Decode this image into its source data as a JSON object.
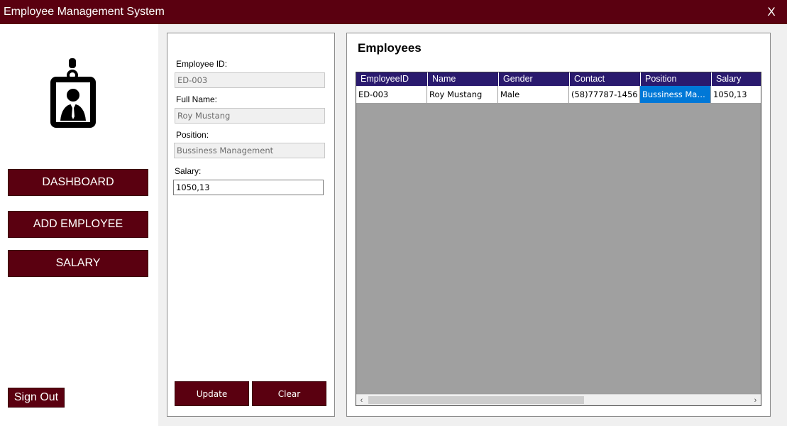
{
  "window": {
    "title": "Employee Management System",
    "close_label": "X"
  },
  "sidebar": {
    "nav": [
      {
        "label": "DASHBOARD"
      },
      {
        "label": "ADD EMPLOYEE"
      },
      {
        "label": "SALARY"
      }
    ],
    "sign_out_label": "Sign Out"
  },
  "form": {
    "employee_id": {
      "label": "Employee ID:",
      "value": "ED-003"
    },
    "full_name": {
      "label": "Full Name:",
      "value": "Roy Mustang"
    },
    "position": {
      "label": "Position:",
      "value": "Bussiness Management"
    },
    "salary": {
      "label": "Salary:",
      "value": "1050,13"
    },
    "update_label": "Update",
    "clear_label": "Clear"
  },
  "employees": {
    "title": "Employees",
    "columns": [
      "EmployeeID",
      "Name",
      "Gender",
      "Contact",
      "Position",
      "Salary"
    ],
    "rows": [
      [
        "ED-003",
        "Roy Mustang",
        "Male",
        "(58)77787-1456",
        "Bussiness Management",
        "1050,13"
      ]
    ],
    "scroll_left": "‹",
    "scroll_right": "›"
  }
}
